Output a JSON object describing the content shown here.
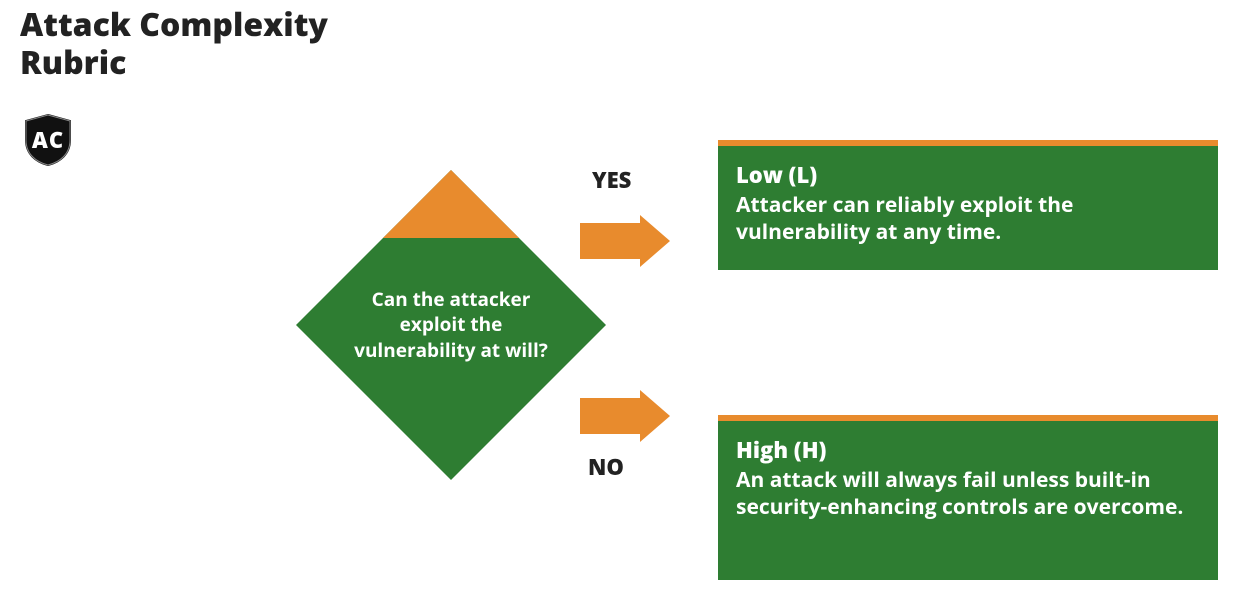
{
  "title_line1": "Attack Complexity",
  "title_line2": "Rubric",
  "badge": "AC",
  "decision": {
    "question": "Can the attacker exploit the vulnerability at will?",
    "yes_label": "YES",
    "no_label": "NO"
  },
  "outcomes": {
    "yes": {
      "title": "Low (L)",
      "body": "Attacker can reliably exploit the vulnerability at any time."
    },
    "no": {
      "title": "High (H)",
      "body": "An attack will always fail unless built-in security-enhancing controls are overcome."
    }
  },
  "colors": {
    "green": "#2e7d32",
    "orange": "#e88b2d",
    "text": "#222"
  }
}
